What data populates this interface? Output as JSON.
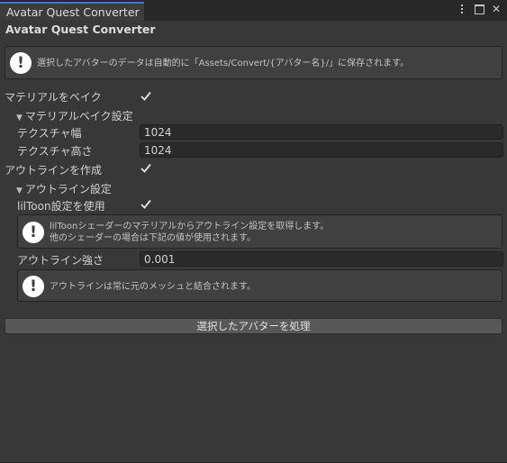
{
  "window": {
    "tab_title": "Avatar Quest Converter",
    "icons": [
      "kebab-menu-icon",
      "maximize-icon",
      "close-icon"
    ],
    "close_glyph": "✕"
  },
  "header": {
    "title": "Avatar Quest Converter"
  },
  "help_save": {
    "icon": "info-icon",
    "icon_glyph": "!",
    "text": "選択したアバターのデータは自動的に「Assets/Convert/{アバター名}/」に保存されます。"
  },
  "material_bake": {
    "label": "マテリアルをベイク",
    "checked": true
  },
  "material_settings": {
    "foldout_label": "マテリアルベイク設定",
    "expanded": true,
    "texture_width_label": "テクスチャ幅",
    "texture_width_value": "1024",
    "texture_height_label": "テクスチャ高さ",
    "texture_height_value": "1024"
  },
  "outline_create": {
    "label": "アウトラインを作成",
    "checked": true
  },
  "outline_settings": {
    "foldout_label": "アウトライン設定",
    "expanded": true,
    "liltoon_label": "lilToon設定を使用",
    "liltoon_checked": true,
    "help_liltoon_line1": "lilToonシェーダーのマテリアルからアウトライン設定を取得します。",
    "help_liltoon_line2": "他のシェーダーの場合は下記の値が使用されます。",
    "strength_label": "アウトライン強さ",
    "strength_value": "0.001",
    "help_combine": "アウトラインは常に元のメッシュと結合されます。"
  },
  "process_button": {
    "label": "選択したアバターを処理"
  },
  "colors": {
    "background": "#383838",
    "tab_accent": "#3a79bb",
    "field_bg": "#2a2a2a",
    "button_bg": "#585858"
  }
}
